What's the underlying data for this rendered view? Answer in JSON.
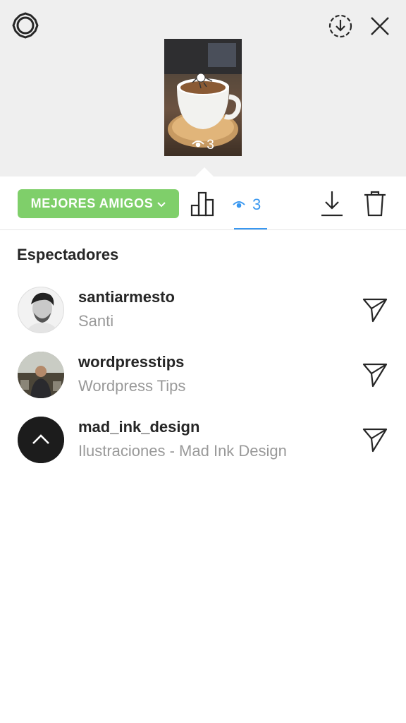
{
  "preview": {
    "view_count": "3"
  },
  "toolbar": {
    "audience_label": "MEJORES AMIGOS",
    "views_count": "3",
    "accent": "#3897f0",
    "audience_color": "#7fcf6a"
  },
  "viewers": {
    "title": "Espectadores",
    "items": [
      {
        "username": "santiarmesto",
        "name": "Santi"
      },
      {
        "username": "wordpresstips",
        "name": "Wordpress Tips"
      },
      {
        "username": "mad_ink_design",
        "name": "Ilustraciones - Mad Ink Design"
      }
    ]
  }
}
